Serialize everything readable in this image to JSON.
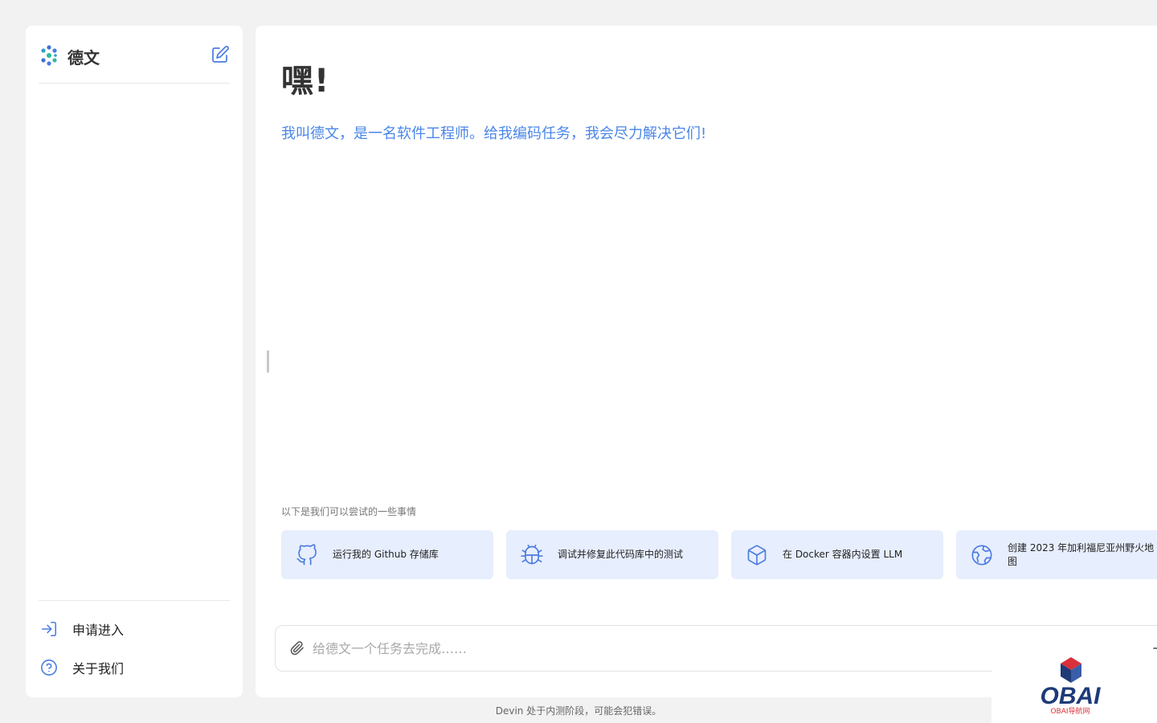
{
  "sidebar": {
    "brand": "德文",
    "logo_icon": "devin-logo-icon",
    "new_icon": "edit-icon",
    "items": [
      {
        "label": "申请进入",
        "icon": "sign-in-icon"
      },
      {
        "label": "关于我们",
        "icon": "help-circle-icon"
      }
    ]
  },
  "main": {
    "greeting": "嘿!",
    "intro": "我叫德文，是一名软件工程师。给我编码任务，我会尽力解决它们!",
    "suggestions_heading": "以下是我们可以尝试的一些事情",
    "suggestions": [
      {
        "label": "运行我的 Github 存储库",
        "icon": "github-icon"
      },
      {
        "label": "调试并修复此代码库中的测试",
        "icon": "bug-icon"
      },
      {
        "label": "在 Docker 容器内设置 LLM",
        "icon": "box-icon"
      },
      {
        "label": "创建 2023 年加利福尼亚州野火地图",
        "icon": "globe-icon"
      }
    ],
    "input": {
      "placeholder": "给德文一个任务去完成……",
      "value": ""
    }
  },
  "footer_note": "Devin 处于内测阶段，可能会犯错误。",
  "watermark": {
    "text": "OBAI",
    "subtext": "OBAI导航网"
  },
  "colors": {
    "accent": "#4a86e8",
    "card_bg": "#e7eefd",
    "page_bg": "#f2f2f2"
  }
}
